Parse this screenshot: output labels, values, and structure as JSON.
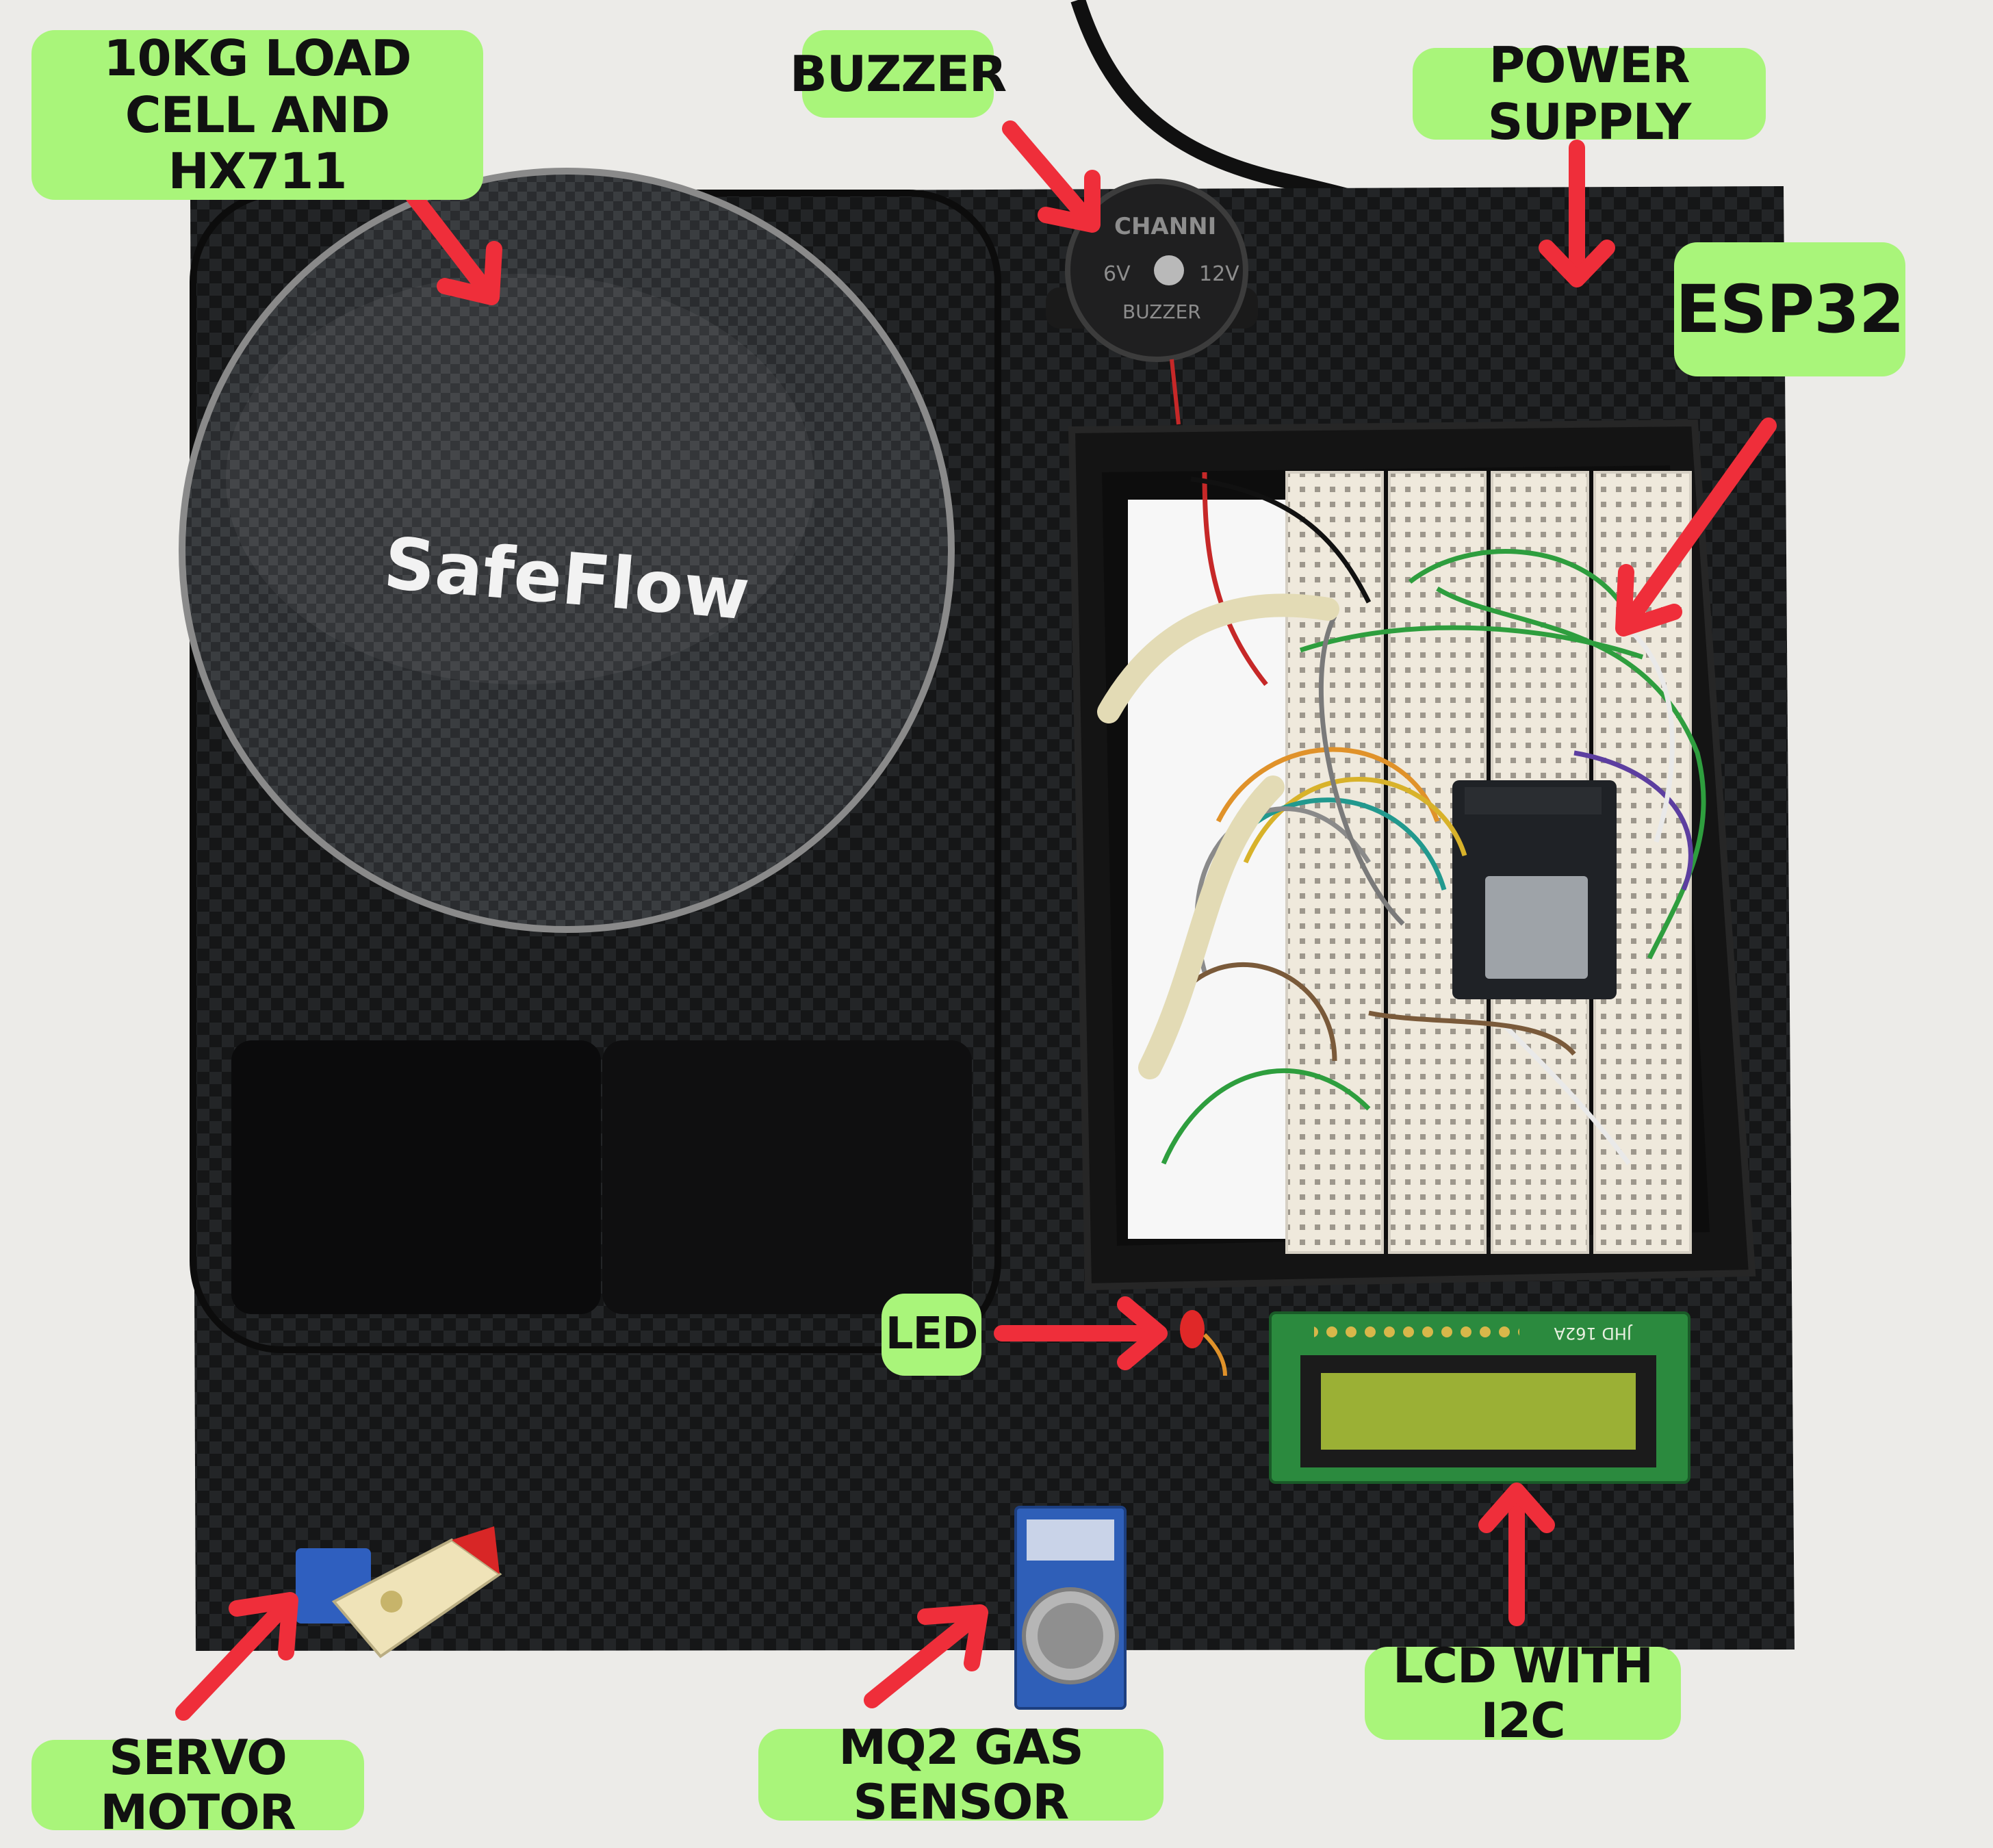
{
  "brand": {
    "logo_text": "SafeFlow"
  },
  "labels": {
    "load_cell": "10KG LOAD CELL AND\nHX711",
    "buzzer": "BUZZER",
    "power_supply": "POWER SUPPLY",
    "esp32": "ESP32",
    "led": "LED",
    "lcd": "LCD WITH I2C",
    "servo": "SERVO MOTOR",
    "gas_sensor": "MQ2 GAS SENSOR"
  },
  "component_markings": {
    "buzzer_brand": "CHANNI",
    "buzzer_left": "6V",
    "buzzer_right": "12V",
    "buzzer_bottom": "BUZZER",
    "lcd_model": "JHD 162A"
  },
  "colors": {
    "label_bg": "#a9f57a",
    "arrow": "#ef2e3a",
    "mat": "#141516",
    "lcd_screen": "#9bb035",
    "lcd_pcb": "#2b8a3e"
  }
}
